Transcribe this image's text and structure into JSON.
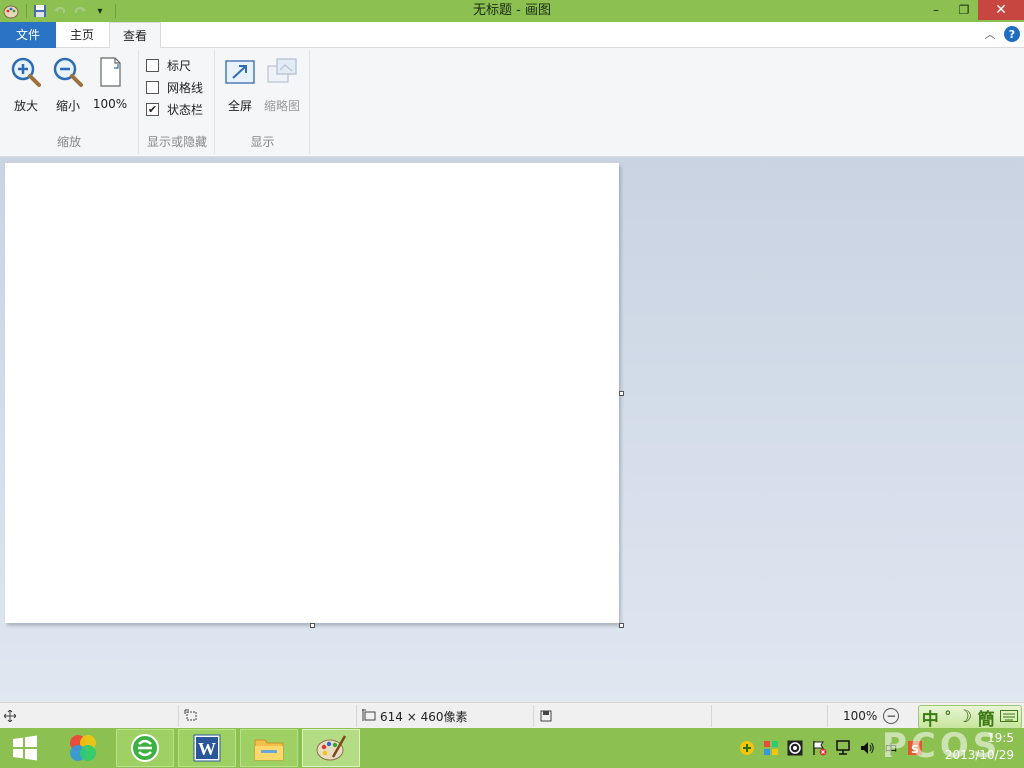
{
  "window": {
    "title": "无标题 - 画图",
    "controls": {
      "minimize": "–",
      "restore": "❐",
      "close": "✕"
    }
  },
  "quick_access": {
    "icons": [
      "paint-app-icon",
      "save-icon",
      "undo-icon",
      "redo-icon",
      "customize-dropdown-icon"
    ]
  },
  "tabs": {
    "file": "文件",
    "home": "主页",
    "view": "查看"
  },
  "ribbon": {
    "zoom_group": {
      "label": "缩放",
      "zoom_in": "放大",
      "zoom_out": "缩小",
      "actual_size": "100%"
    },
    "show_hide_group": {
      "label": "显示或隐藏",
      "ruler": {
        "label": "标尺",
        "checked": false
      },
      "gridlines": {
        "label": "网格线",
        "checked": false
      },
      "statusbar": {
        "label": "状态栏",
        "checked": true
      }
    },
    "display_group": {
      "label": "显示",
      "fullscreen": "全屏",
      "thumbnail": "缩略图"
    }
  },
  "statusbar": {
    "canvas_size": "614 × 460像素",
    "zoom_level": "100%",
    "ime_mode": "中",
    "ime_script": "簡"
  },
  "taskbar": {
    "clock_time": "19:5",
    "clock_date": "2013/10/29",
    "tray_ime": "中"
  },
  "watermark": "PCOS",
  "colors": {
    "title_bar": "#8cc152",
    "file_tab": "#2a73c5",
    "close_button": "#c7463f",
    "taskbar": "#8cc152"
  }
}
